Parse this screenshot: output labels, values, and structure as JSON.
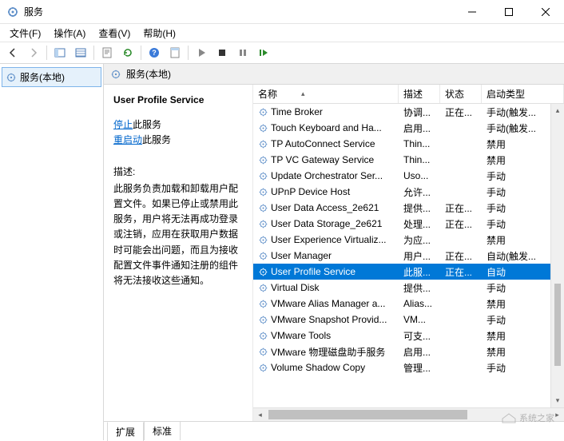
{
  "window": {
    "title": "服务"
  },
  "menu": {
    "file": "文件(F)",
    "action": "操作(A)",
    "view": "查看(V)",
    "help": "帮助(H)"
  },
  "nav": {
    "local_services": "服务(本地)"
  },
  "content_header": "服务(本地)",
  "detail": {
    "service_name": "User Profile Service",
    "stop_link": "停止",
    "stop_suffix": "此服务",
    "restart_link": "重启动",
    "restart_suffix": "此服务",
    "desc_label": "描述:",
    "description": "此服务负责加载和卸载用户配置文件。如果已停止或禁用此服务，用户将无法再成功登录或注销，应用在获取用户数据时可能会出问题，而且为接收配置文件事件通知注册的组件将无法接收这些通知。"
  },
  "columns": {
    "name": "名称",
    "desc": "描述",
    "status": "状态",
    "startup": "启动类型"
  },
  "services": [
    {
      "name": "Time Broker",
      "desc": "协调...",
      "status": "正在...",
      "startup": "手动(触发..."
    },
    {
      "name": "Touch Keyboard and Ha...",
      "desc": "启用...",
      "status": "",
      "startup": "手动(触发..."
    },
    {
      "name": "TP AutoConnect Service",
      "desc": "Thin...",
      "status": "",
      "startup": "禁用"
    },
    {
      "name": "TP VC Gateway Service",
      "desc": "Thin...",
      "status": "",
      "startup": "禁用"
    },
    {
      "name": "Update Orchestrator Ser...",
      "desc": "Uso...",
      "status": "",
      "startup": "手动"
    },
    {
      "name": "UPnP Device Host",
      "desc": "允许...",
      "status": "",
      "startup": "手动"
    },
    {
      "name": "User Data Access_2e621",
      "desc": "提供...",
      "status": "正在...",
      "startup": "手动"
    },
    {
      "name": "User Data Storage_2e621",
      "desc": "处理...",
      "status": "正在...",
      "startup": "手动"
    },
    {
      "name": "User Experience Virtualiz...",
      "desc": "为应...",
      "status": "",
      "startup": "禁用"
    },
    {
      "name": "User Manager",
      "desc": "用户...",
      "status": "正在...",
      "startup": "自动(触发..."
    },
    {
      "name": "User Profile Service",
      "desc": "此服...",
      "status": "正在...",
      "startup": "自动",
      "selected": true
    },
    {
      "name": "Virtual Disk",
      "desc": "提供...",
      "status": "",
      "startup": "手动"
    },
    {
      "name": "VMware Alias Manager a...",
      "desc": "Alias...",
      "status": "",
      "startup": "禁用"
    },
    {
      "name": "VMware Snapshot Provid...",
      "desc": "VM...",
      "status": "",
      "startup": "手动"
    },
    {
      "name": "VMware Tools",
      "desc": "可支...",
      "status": "",
      "startup": "禁用"
    },
    {
      "name": "VMware 物理磁盘助手服务",
      "desc": "启用...",
      "status": "",
      "startup": "禁用"
    },
    {
      "name": "Volume Shadow Copy",
      "desc": "管理...",
      "status": "",
      "startup": "手动"
    }
  ],
  "tabs": {
    "extended": "扩展",
    "standard": "标准"
  },
  "watermark": "系统之家"
}
